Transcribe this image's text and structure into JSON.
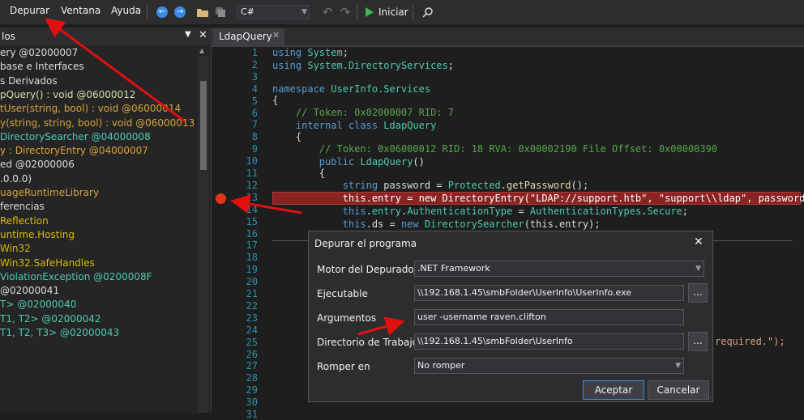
{
  "menu": {
    "debug": "Depurar",
    "window": "Ventana",
    "help": "Ayuda"
  },
  "toolbar": {
    "language": "C#",
    "start": "Iniciar"
  },
  "left_panel": {
    "title": "los",
    "items": [
      {
        "text": "ery @02000007",
        "color": "#dcdcdc"
      },
      {
        "text": "base e Interfaces",
        "color": "#dcdcdc"
      },
      {
        "text": "s Derivados",
        "color": "#dcdcdc"
      },
      {
        "text": "pQuery() : void @06000012",
        "color": "#dcdcaa"
      },
      {
        "text": "tUser(string, bool) : void @06000014",
        "color": "#d7a33d"
      },
      {
        "text": "y(string, string, bool) : void @06000013",
        "color": "#d7a33d"
      },
      {
        "text": "DirectorySearcher @04000008",
        "color": "#4ec9b0"
      },
      {
        "text": "y : DirectoryEntry @04000007",
        "color": "#d7a33d"
      },
      {
        "text": "ed @02000006",
        "color": "#dcdcdc"
      },
      {
        "text": ".0.0.0)",
        "color": "#dcdcdc"
      },
      {
        "text": "uageRuntimeLibrary",
        "color": "#d7a33d"
      },
      {
        "text": "ferencias",
        "color": "#dcdcdc"
      },
      {
        "text": "Reflection",
        "color": "#d7ba00"
      },
      {
        "text": "untime.Hosting",
        "color": "#d7ba00"
      },
      {
        "text": "Win32",
        "color": "#d7ba00"
      },
      {
        "text": "Win32.SafeHandles",
        "color": "#d7ba00"
      },
      {
        "text": "ViolationException @0200008F",
        "color": "#4ec9b0"
      },
      {
        "text": "@02000041",
        "color": "#dcdcdc"
      },
      {
        "text": "T> @02000040",
        "color": "#4ec9b0"
      },
      {
        "text": "T1, T2> @02000042",
        "color": "#4ec9b0"
      },
      {
        "text": "T1, T2, T3> @02000043",
        "color": "#4ec9b0"
      }
    ]
  },
  "editor": {
    "tab": "LdapQuery",
    "lines": [
      "1",
      "2",
      "3",
      "4",
      "5",
      "6",
      "7",
      "8",
      "9",
      "10",
      "11",
      "12",
      "13",
      "14",
      "15",
      "16",
      "17",
      "18",
      "19",
      "20",
      "21",
      "22",
      "23",
      "24",
      "25",
      "26",
      "27",
      "28",
      "29",
      "30",
      "31"
    ]
  },
  "code": {
    "l1a": "using",
    "l1b": "System",
    "l1c": ";",
    "l2a": "using",
    "l2b": "System.DirectoryServices",
    "l2c": ";",
    "l4a": "namespace",
    "l4b": "UserInfo.Services",
    "l5": "{",
    "l6": "    // Token: 0x02000007 RID: 7",
    "l7a": "    internal class",
    "l7b": "LdapQuery",
    "l8": "    {",
    "l9": "        // Token: 0x06000012 RID: 18 RVA: 0x00002190 File Offset: 0x00000390",
    "l10a": "        public",
    "l10b": "LdapQuery",
    "l10c": "()",
    "l11": "        {",
    "l12a": "            string",
    "l12b": " password = ",
    "l12c": "Protected",
    "l12d": ".",
    "l12e": "getPassword",
    "l12f": "();",
    "l13": "            this.entry = new DirectoryEntry(\"LDAP://support.htb\", \"support\\\\ldap\", password);",
    "l14a": "            this",
    "l14b": ".",
    "l14c": "entry",
    "l14d": ".",
    "l14e": "AuthenticationType",
    "l14f": " = ",
    "l14g": "AuthenticationTypes",
    "l14h": ".",
    "l14i": "Secure",
    "l14j": ";",
    "l15a": "            this",
    "l15b": ".ds = ",
    "l15c": "new",
    "l15d": " DirectorySearcher",
    "l15e": "(this.entry);",
    "l22": "required.\");"
  },
  "dialog": {
    "title": "Depurar el programa",
    "engine_label": "Motor del Depurador",
    "engine_value": ".NET Framework",
    "exe_label": "Ejecutable",
    "exe_value": "\\\\192.168.1.45\\smbFolder\\UserInfo\\UserInfo.exe",
    "args_label": "Argumentos",
    "args_value": "user -username raven.clifton",
    "dir_label": "Directorio de Trabajo",
    "dir_value": "\\\\192.168.1.45\\smbFolder\\UserInfo",
    "break_label": "Romper en",
    "break_value": "No romper",
    "browse": "...",
    "ok": "Aceptar",
    "cancel": "Cancelar"
  },
  "colors": {
    "accent": "#3c8ce7",
    "annotation_arrow": "#e01010",
    "breakpoint": "#e5331b"
  }
}
